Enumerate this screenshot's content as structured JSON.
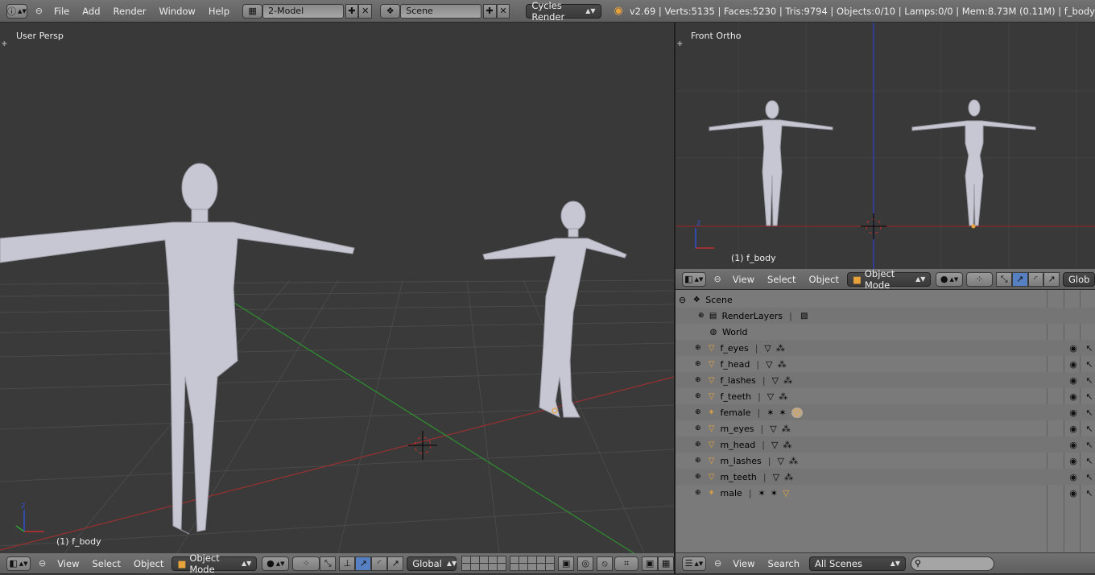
{
  "topbar": {
    "menus": [
      "File",
      "Add",
      "Render",
      "Window",
      "Help"
    ],
    "screen_layout": "2-Model",
    "scene": "Scene",
    "render_engine": "Cycles Render",
    "stats": "v2.69 | Verts:5135 | Faces:5230 | Tris:9794 | Objects:0/10 | Lamps:0/0 | Mem:8.73M (0.11M) | f_body"
  },
  "viewport_left": {
    "label": "User Persp",
    "active_object": "(1) f_body"
  },
  "viewport_right": {
    "label": "Front Ortho",
    "active_object": "(1) f_body"
  },
  "header_3d_right": {
    "menus": [
      "View",
      "Select",
      "Object"
    ],
    "mode": "Object Mode",
    "orientation": "Glob"
  },
  "header_3d_left": {
    "menus": [
      "View",
      "Select",
      "Object"
    ],
    "mode": "Object Mode",
    "orientation": "Global"
  },
  "outliner": {
    "root": "Scene",
    "items": [
      {
        "name": "RenderLayers",
        "type": "renderlayers"
      },
      {
        "name": "World",
        "type": "world"
      },
      {
        "name": "f_eyes",
        "type": "mesh"
      },
      {
        "name": "f_head",
        "type": "mesh"
      },
      {
        "name": "f_lashes",
        "type": "mesh"
      },
      {
        "name": "f_teeth",
        "type": "mesh"
      },
      {
        "name": "female",
        "type": "armature"
      },
      {
        "name": "m_eyes",
        "type": "mesh"
      },
      {
        "name": "m_head",
        "type": "mesh"
      },
      {
        "name": "m_lashes",
        "type": "mesh"
      },
      {
        "name": "m_teeth",
        "type": "mesh"
      },
      {
        "name": "male",
        "type": "armature"
      }
    ]
  },
  "outliner_header": {
    "menus": [
      "View",
      "Search"
    ],
    "display_mode": "All Scenes",
    "search_placeholder": ""
  },
  "colors": {
    "accent_mesh": "#e8a23a",
    "grid_red": "#b03030",
    "grid_green": "#3aa03a",
    "z_axis_blue": "#2a3fd0"
  }
}
